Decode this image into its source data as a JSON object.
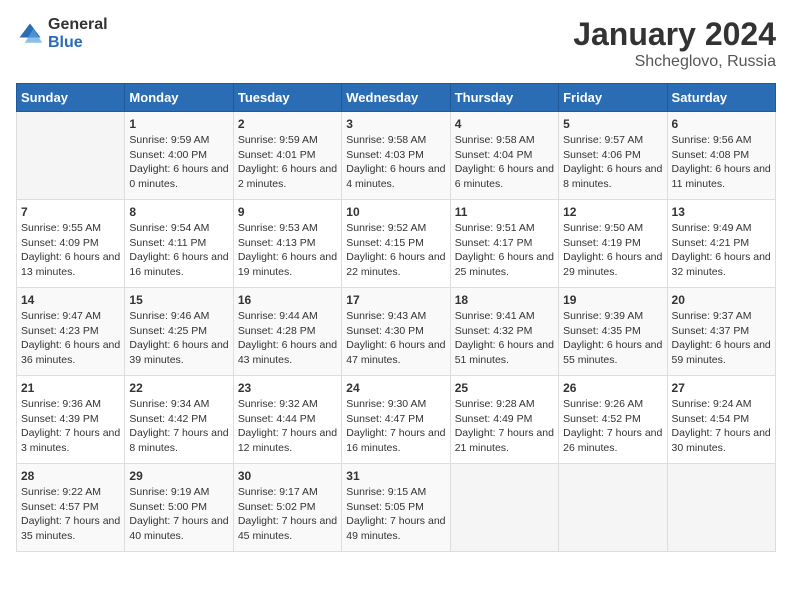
{
  "logo": {
    "general": "General",
    "blue": "Blue"
  },
  "header": {
    "month_year": "January 2024",
    "location": "Shcheglovo, Russia"
  },
  "weekdays": [
    "Sunday",
    "Monday",
    "Tuesday",
    "Wednesday",
    "Thursday",
    "Friday",
    "Saturday"
  ],
  "weeks": [
    [
      {
        "day": "",
        "sunrise": "",
        "sunset": "",
        "daylight": ""
      },
      {
        "day": "1",
        "sunrise": "Sunrise: 9:59 AM",
        "sunset": "Sunset: 4:00 PM",
        "daylight": "Daylight: 6 hours and 0 minutes."
      },
      {
        "day": "2",
        "sunrise": "Sunrise: 9:59 AM",
        "sunset": "Sunset: 4:01 PM",
        "daylight": "Daylight: 6 hours and 2 minutes."
      },
      {
        "day": "3",
        "sunrise": "Sunrise: 9:58 AM",
        "sunset": "Sunset: 4:03 PM",
        "daylight": "Daylight: 6 hours and 4 minutes."
      },
      {
        "day": "4",
        "sunrise": "Sunrise: 9:58 AM",
        "sunset": "Sunset: 4:04 PM",
        "daylight": "Daylight: 6 hours and 6 minutes."
      },
      {
        "day": "5",
        "sunrise": "Sunrise: 9:57 AM",
        "sunset": "Sunset: 4:06 PM",
        "daylight": "Daylight: 6 hours and 8 minutes."
      },
      {
        "day": "6",
        "sunrise": "Sunrise: 9:56 AM",
        "sunset": "Sunset: 4:08 PM",
        "daylight": "Daylight: 6 hours and 11 minutes."
      }
    ],
    [
      {
        "day": "7",
        "sunrise": "Sunrise: 9:55 AM",
        "sunset": "Sunset: 4:09 PM",
        "daylight": "Daylight: 6 hours and 13 minutes."
      },
      {
        "day": "8",
        "sunrise": "Sunrise: 9:54 AM",
        "sunset": "Sunset: 4:11 PM",
        "daylight": "Daylight: 6 hours and 16 minutes."
      },
      {
        "day": "9",
        "sunrise": "Sunrise: 9:53 AM",
        "sunset": "Sunset: 4:13 PM",
        "daylight": "Daylight: 6 hours and 19 minutes."
      },
      {
        "day": "10",
        "sunrise": "Sunrise: 9:52 AM",
        "sunset": "Sunset: 4:15 PM",
        "daylight": "Daylight: 6 hours and 22 minutes."
      },
      {
        "day": "11",
        "sunrise": "Sunrise: 9:51 AM",
        "sunset": "Sunset: 4:17 PM",
        "daylight": "Daylight: 6 hours and 25 minutes."
      },
      {
        "day": "12",
        "sunrise": "Sunrise: 9:50 AM",
        "sunset": "Sunset: 4:19 PM",
        "daylight": "Daylight: 6 hours and 29 minutes."
      },
      {
        "day": "13",
        "sunrise": "Sunrise: 9:49 AM",
        "sunset": "Sunset: 4:21 PM",
        "daylight": "Daylight: 6 hours and 32 minutes."
      }
    ],
    [
      {
        "day": "14",
        "sunrise": "Sunrise: 9:47 AM",
        "sunset": "Sunset: 4:23 PM",
        "daylight": "Daylight: 6 hours and 36 minutes."
      },
      {
        "day": "15",
        "sunrise": "Sunrise: 9:46 AM",
        "sunset": "Sunset: 4:25 PM",
        "daylight": "Daylight: 6 hours and 39 minutes."
      },
      {
        "day": "16",
        "sunrise": "Sunrise: 9:44 AM",
        "sunset": "Sunset: 4:28 PM",
        "daylight": "Daylight: 6 hours and 43 minutes."
      },
      {
        "day": "17",
        "sunrise": "Sunrise: 9:43 AM",
        "sunset": "Sunset: 4:30 PM",
        "daylight": "Daylight: 6 hours and 47 minutes."
      },
      {
        "day": "18",
        "sunrise": "Sunrise: 9:41 AM",
        "sunset": "Sunset: 4:32 PM",
        "daylight": "Daylight: 6 hours and 51 minutes."
      },
      {
        "day": "19",
        "sunrise": "Sunrise: 9:39 AM",
        "sunset": "Sunset: 4:35 PM",
        "daylight": "Daylight: 6 hours and 55 minutes."
      },
      {
        "day": "20",
        "sunrise": "Sunrise: 9:37 AM",
        "sunset": "Sunset: 4:37 PM",
        "daylight": "Daylight: 6 hours and 59 minutes."
      }
    ],
    [
      {
        "day": "21",
        "sunrise": "Sunrise: 9:36 AM",
        "sunset": "Sunset: 4:39 PM",
        "daylight": "Daylight: 7 hours and 3 minutes."
      },
      {
        "day": "22",
        "sunrise": "Sunrise: 9:34 AM",
        "sunset": "Sunset: 4:42 PM",
        "daylight": "Daylight: 7 hours and 8 minutes."
      },
      {
        "day": "23",
        "sunrise": "Sunrise: 9:32 AM",
        "sunset": "Sunset: 4:44 PM",
        "daylight": "Daylight: 7 hours and 12 minutes."
      },
      {
        "day": "24",
        "sunrise": "Sunrise: 9:30 AM",
        "sunset": "Sunset: 4:47 PM",
        "daylight": "Daylight: 7 hours and 16 minutes."
      },
      {
        "day": "25",
        "sunrise": "Sunrise: 9:28 AM",
        "sunset": "Sunset: 4:49 PM",
        "daylight": "Daylight: 7 hours and 21 minutes."
      },
      {
        "day": "26",
        "sunrise": "Sunrise: 9:26 AM",
        "sunset": "Sunset: 4:52 PM",
        "daylight": "Daylight: 7 hours and 26 minutes."
      },
      {
        "day": "27",
        "sunrise": "Sunrise: 9:24 AM",
        "sunset": "Sunset: 4:54 PM",
        "daylight": "Daylight: 7 hours and 30 minutes."
      }
    ],
    [
      {
        "day": "28",
        "sunrise": "Sunrise: 9:22 AM",
        "sunset": "Sunset: 4:57 PM",
        "daylight": "Daylight: 7 hours and 35 minutes."
      },
      {
        "day": "29",
        "sunrise": "Sunrise: 9:19 AM",
        "sunset": "Sunset: 5:00 PM",
        "daylight": "Daylight: 7 hours and 40 minutes."
      },
      {
        "day": "30",
        "sunrise": "Sunrise: 9:17 AM",
        "sunset": "Sunset: 5:02 PM",
        "daylight": "Daylight: 7 hours and 45 minutes."
      },
      {
        "day": "31",
        "sunrise": "Sunrise: 9:15 AM",
        "sunset": "Sunset: 5:05 PM",
        "daylight": "Daylight: 7 hours and 49 minutes."
      },
      {
        "day": "",
        "sunrise": "",
        "sunset": "",
        "daylight": ""
      },
      {
        "day": "",
        "sunrise": "",
        "sunset": "",
        "daylight": ""
      },
      {
        "day": "",
        "sunrise": "",
        "sunset": "",
        "daylight": ""
      }
    ]
  ]
}
